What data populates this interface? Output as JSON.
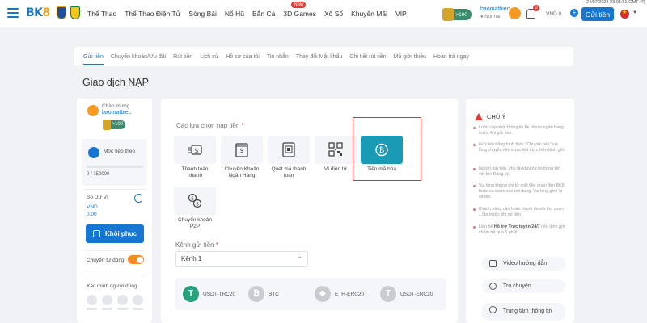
{
  "header": {
    "logo_main": "BK",
    "logo_accent": "8",
    "nav": [
      {
        "label": "Thể Thao"
      },
      {
        "label": "Thể Thao Điện Tử"
      },
      {
        "label": "Sòng Bài"
      },
      {
        "label": "Nổ Hũ"
      },
      {
        "label": "Bắn Cá"
      },
      {
        "label": "3D Games",
        "badge": "New"
      },
      {
        "label": "Xổ Số"
      },
      {
        "label": "Khuyến Mãi"
      },
      {
        "label": "VIP"
      }
    ],
    "level": ">100",
    "username": "baomatbiec",
    "rank": "● Normal",
    "notifications": "0",
    "currency": "VND",
    "balance": "0",
    "deposit_button": "Gửi tiền",
    "datetime": "24/07/2023 23:05:51(GMT+7)",
    "colors": {
      "primary": "#1677d2",
      "accent": "#f58c23",
      "highlight": "#e32d2d"
    }
  },
  "tabs": [
    {
      "label": "Gửi tiền",
      "active": true
    },
    {
      "label": "Chuyển khoản/Ưu đãi"
    },
    {
      "label": "Rút tiền"
    },
    {
      "label": "Lịch sử"
    },
    {
      "label": "Hồ sơ của tôi"
    },
    {
      "label": "Tin nhắn"
    },
    {
      "label": "Thay đổi Mật khẩu"
    },
    {
      "label": "Chi tiết rút tiền"
    },
    {
      "label": "Mã giới thiệu"
    },
    {
      "label": "Hoàn trả ngay"
    }
  ],
  "page_title": "Giao dịch NẠP",
  "left": {
    "welcome": "Chào mừng",
    "username": "baomatbiec",
    "level": ">100",
    "milestone_label": "Mốc tiếp theo",
    "milestone_value": "0 / 150000",
    "milestone_progress": 0,
    "balance_label": "Số Dư Ví",
    "balance_currency": "VND",
    "balance_value": "0.00",
    "restore_button": "Khôi phục",
    "auto_transfer_label": "Chuyển tự động",
    "auto_transfer_on": true,
    "verify_label": "Xác minh người dùng"
  },
  "main": {
    "options_label": "Các lựa chọn nạp tiền",
    "required_mark": "*",
    "methods": [
      {
        "label": "Thanh toán nhanh",
        "icon": "fast-payment-icon"
      },
      {
        "label": "Chuyển Khoản Ngân Hàng",
        "icon": "bank-icon"
      },
      {
        "label": "Quét mã thanh toán",
        "icon": "scan-code-icon"
      },
      {
        "label": "Ví điện tử",
        "icon": "qr-wallet-icon"
      },
      {
        "label": "Tiền mã hóa",
        "icon": "crypto-icon",
        "selected": true
      },
      {
        "label": "Chuyển khoản P2P",
        "icon": "p2p-icon"
      }
    ],
    "channel_label": "Kênh gửi tiền",
    "channel_value": "Kênh 1",
    "coins": [
      {
        "label": "USDT-TRC20",
        "color": "#26a17b",
        "symbol": "T"
      },
      {
        "label": "BTC",
        "color": "#c9ccd1",
        "symbol": "₿"
      },
      {
        "label": "ETH-ERC20",
        "color": "#c9ccd1",
        "symbol": "◆"
      },
      {
        "label": "USDT-ERC20",
        "color": "#c9ccd1",
        "symbol": "T"
      }
    ]
  },
  "right": {
    "title": "CHÚ Ý",
    "notes": [
      "Luôn cập nhật thông tin tài khoản ngân hàng trước khi gửi tiền.",
      "Gửi tiền bằng hình thức \"Chuyển tiền\" vui lòng chuyển tiền trước khi thực hiện lệnh gửi.",
      "Người gửi tiền, chủ tài khoản cần trùng tên với tên Đăng ký.",
      "Vui lòng không ghi từ ngữ liên quan đến BK8 hoặc cá cược vào nội dung. Vui lòng ghi Họ và tên.",
      "Khách hàng cần hoàn thành doanh thu cược 1 lần trước khi rút tiền."
    ],
    "last_note_pre": "Liên hệ ",
    "last_note_bold": "Hỗ trợ Trực tuyến 24/7",
    "last_note_post": " nếu lệnh gửi chậm trễ quá 5 phút.",
    "help": [
      {
        "label": "Video hướng dẫn",
        "icon": "video-icon"
      },
      {
        "label": "Trò chuyện",
        "icon": "chat-icon"
      },
      {
        "label": "Trung tâm thông tin",
        "icon": "info-icon"
      }
    ]
  }
}
